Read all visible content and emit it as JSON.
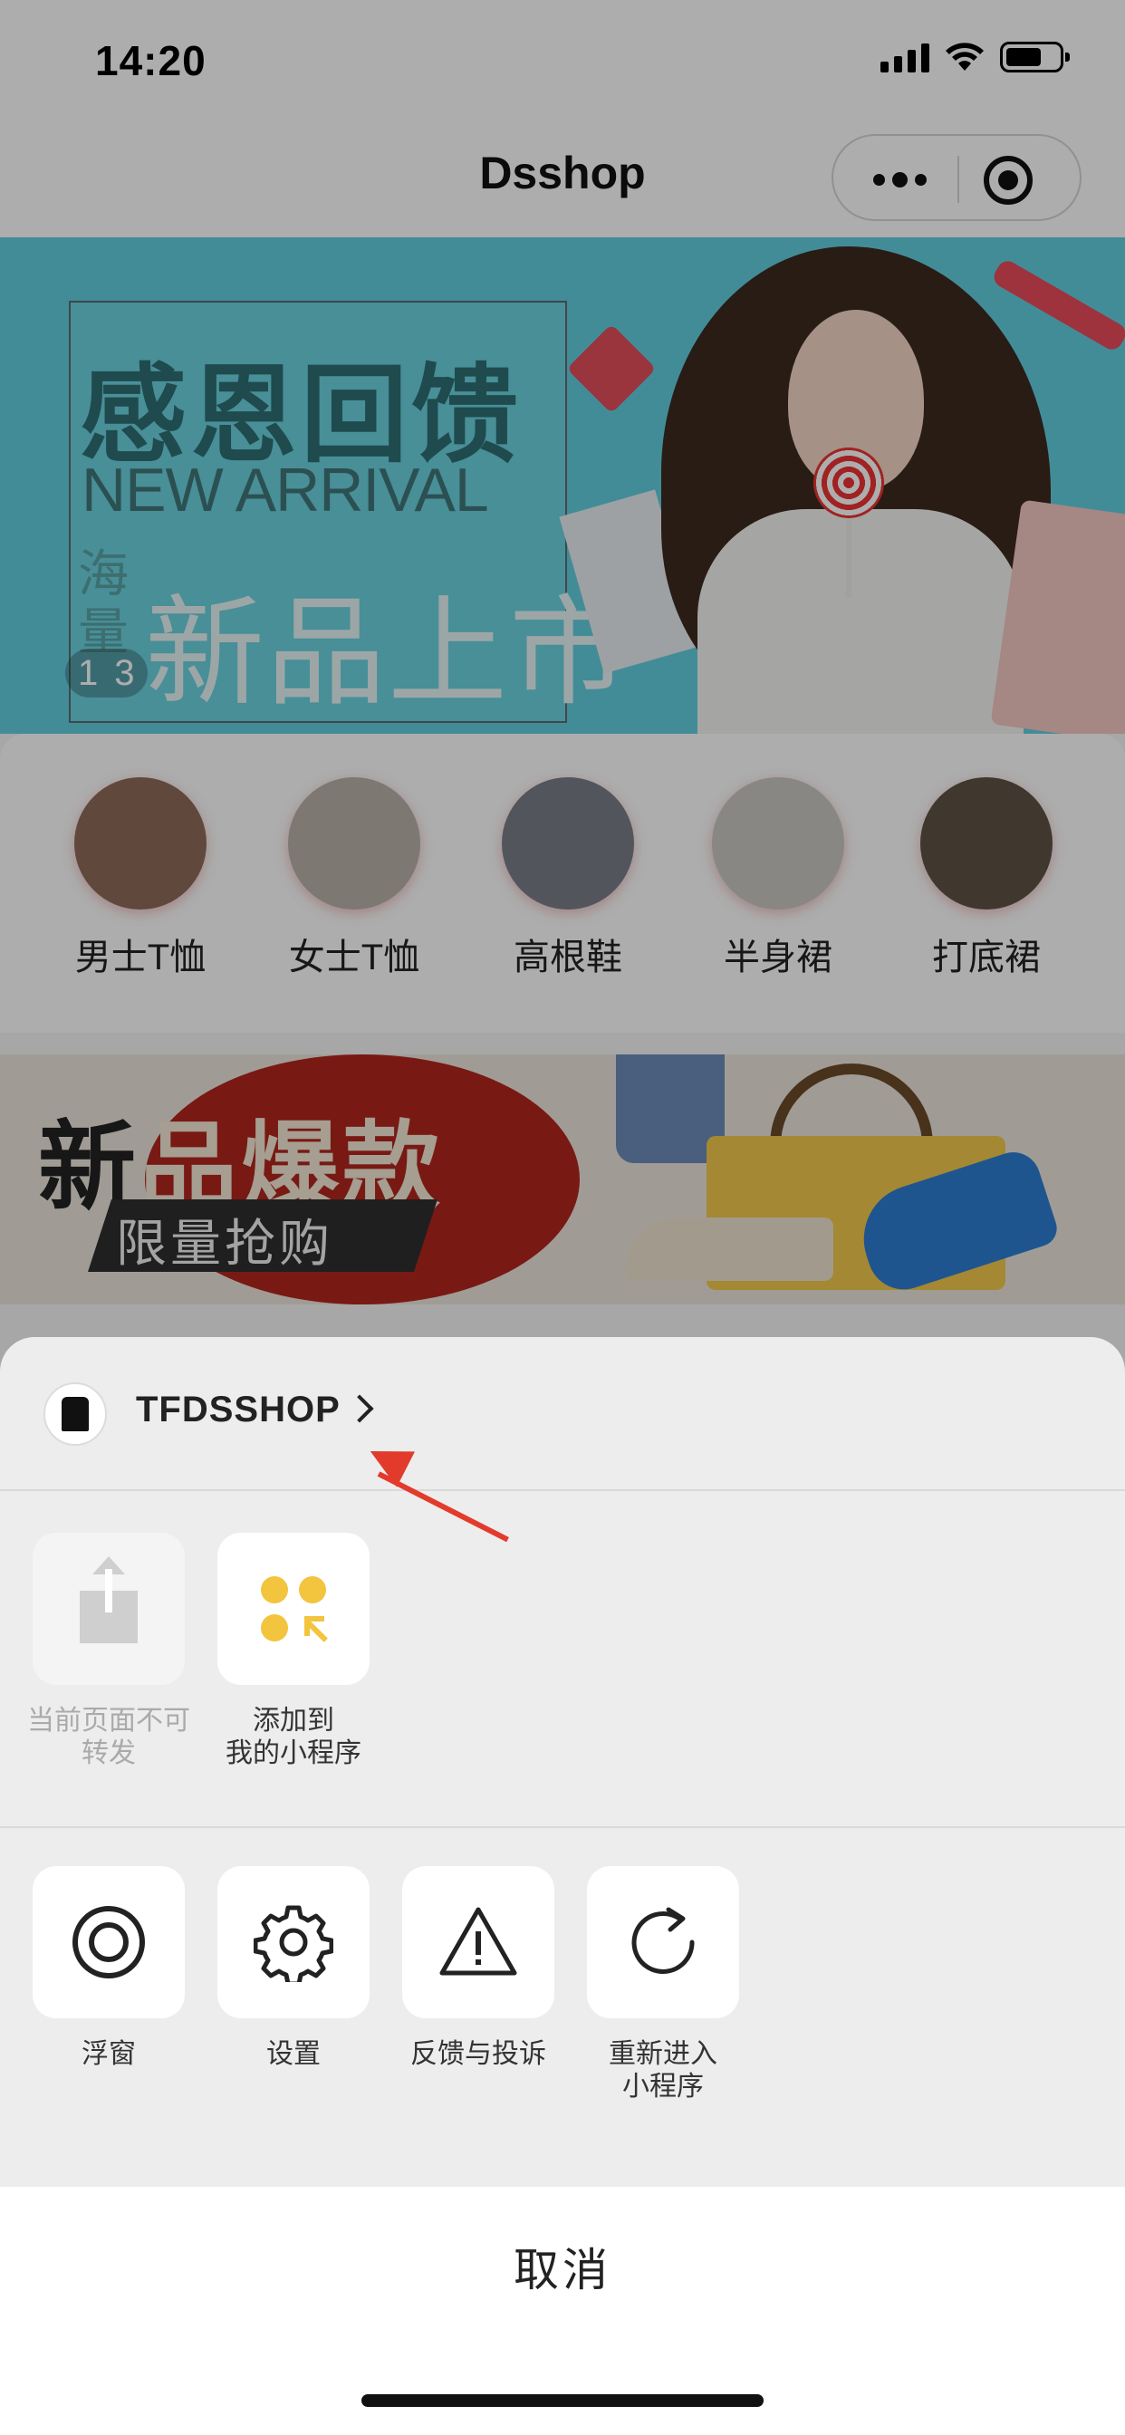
{
  "status_bar": {
    "time": "14:20"
  },
  "nav": {
    "title": "Dsshop"
  },
  "banner": {
    "title": "感恩回馈",
    "subtitle": "NEW ARRIVAL",
    "side_text": "海量",
    "main_text": "新品上市",
    "page_current": "1",
    "page_total": "3"
  },
  "categories": [
    {
      "label": "男士T恤",
      "color": "#8f6b5a"
    },
    {
      "label": "女士T恤",
      "color": "#b9b1a8"
    },
    {
      "label": "高根鞋",
      "color": "#7a7f88"
    },
    {
      "label": "半身裙",
      "color": "#c9c7c2"
    },
    {
      "label": "打底裙",
      "color": "#5f5346"
    }
  ],
  "promo": {
    "title_dark": "新",
    "title_light": "品爆款",
    "subtitle": "限量抢购"
  },
  "sheet": {
    "app_name": "TFDSSHOP",
    "actions_top": [
      {
        "label_line1": "当前页面不可",
        "label_line2": "转发",
        "icon": "share-icon",
        "enabled": false
      },
      {
        "label_line1": "添加到",
        "label_line2": "我的小程序",
        "icon": "add-to-my-miniprogram-icon",
        "enabled": true
      }
    ],
    "actions_bottom": [
      {
        "label_line1": "浮窗",
        "label_line2": "",
        "icon": "float-window-icon"
      },
      {
        "label_line1": "设置",
        "label_line2": "",
        "icon": "gear-icon"
      },
      {
        "label_line1": "反馈与投诉",
        "label_line2": "",
        "icon": "warning-icon"
      },
      {
        "label_line1": "重新进入",
        "label_line2": "小程序",
        "icon": "reload-icon"
      }
    ],
    "cancel_label": "取消"
  },
  "colors": {
    "accent_yellow": "#f3c43e",
    "annotation_red": "#e23b2c",
    "banner_cyan": "#62cfe0"
  }
}
